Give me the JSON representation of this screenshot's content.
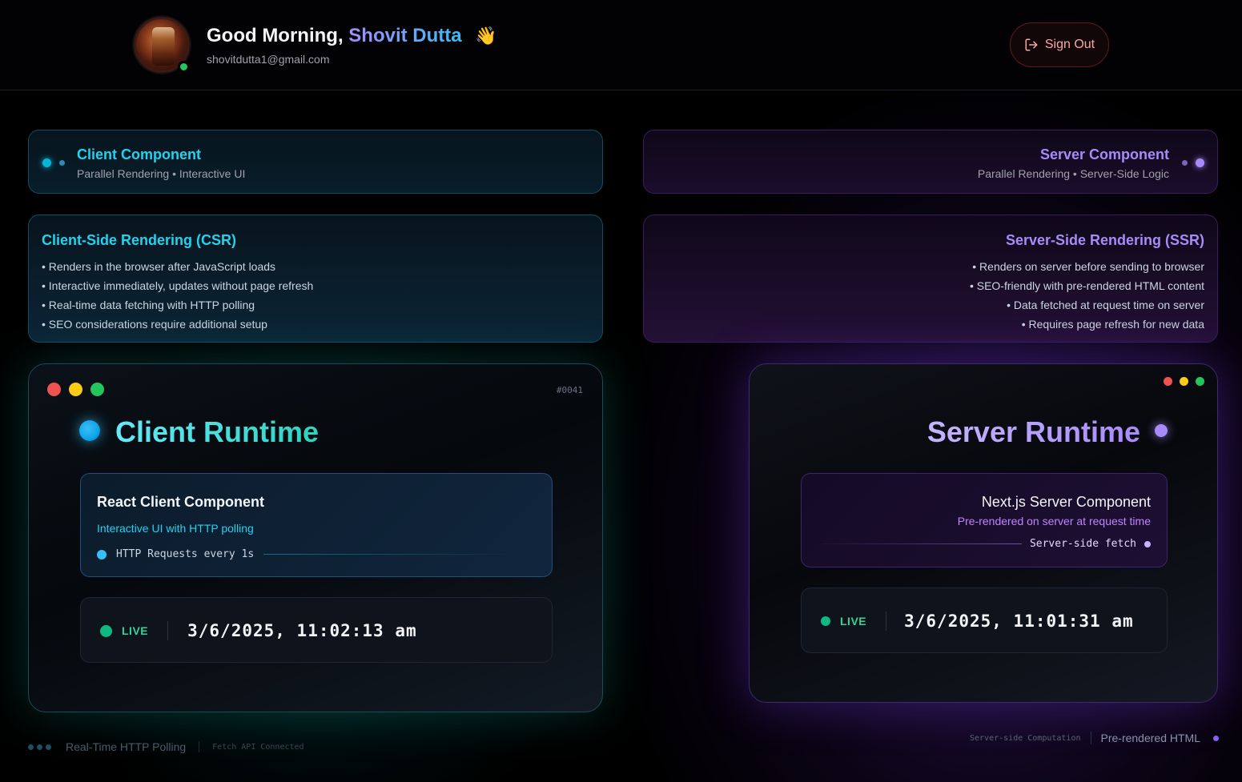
{
  "header": {
    "greeting": "Good Morning,",
    "user_name": "Shovit Dutta",
    "wave_emoji": "👋",
    "email": "shovitdutta1@gmail.com",
    "sign_out_label": "Sign Out",
    "sign_out_icon": "sign-out-icon",
    "online_status": "online"
  },
  "client_component": {
    "title": "Client Component",
    "subtitle": "Parallel Rendering • Interactive UI"
  },
  "server_component": {
    "title": "Server Component",
    "subtitle": "Parallel Rendering • Server-Side Logic"
  },
  "csr": {
    "title": "Client-Side Rendering (CSR)",
    "bullets": [
      "• Renders in the browser after JavaScript loads",
      "• Interactive immediately, updates without page refresh",
      "• Real-time data fetching with HTTP polling",
      "• SEO considerations require additional setup"
    ]
  },
  "ssr": {
    "title": "Server-Side Rendering (SSR)",
    "bullets": [
      "• Renders on server before sending to browser",
      "• SEO-friendly with pre-rendered HTML content",
      "• Data fetched at request time on server",
      "• Requires page refresh for new data"
    ]
  },
  "client_runtime": {
    "id_tag": "#0041",
    "title": "Client Runtime",
    "card_title": "React Client Component",
    "card_subtitle": "Interactive UI with HTTP polling",
    "polling_label": "HTTP Requests every 1s",
    "live_label": "LIVE",
    "timestamp": "3/6/2025, 11:02:13 am"
  },
  "server_runtime": {
    "title": "Server Runtime",
    "card_title": "Next.js Server Component",
    "card_subtitle": "Pre-rendered on server at request time",
    "fetch_label": "Server-side fetch",
    "live_label": "LIVE",
    "timestamp": "3/6/2025, 11:01:31 am"
  },
  "footer_left": {
    "label": "Real-Time HTTP Polling",
    "status": "Fetch API Connected"
  },
  "footer_right": {
    "status": "Server-side Computation",
    "label": "Pre-rendered HTML"
  },
  "colors": {
    "cyan_accent": "#22d3ee",
    "violet_accent": "#a78bfa",
    "live_green": "#10b981",
    "sign_out_red": "#fca5a5"
  }
}
